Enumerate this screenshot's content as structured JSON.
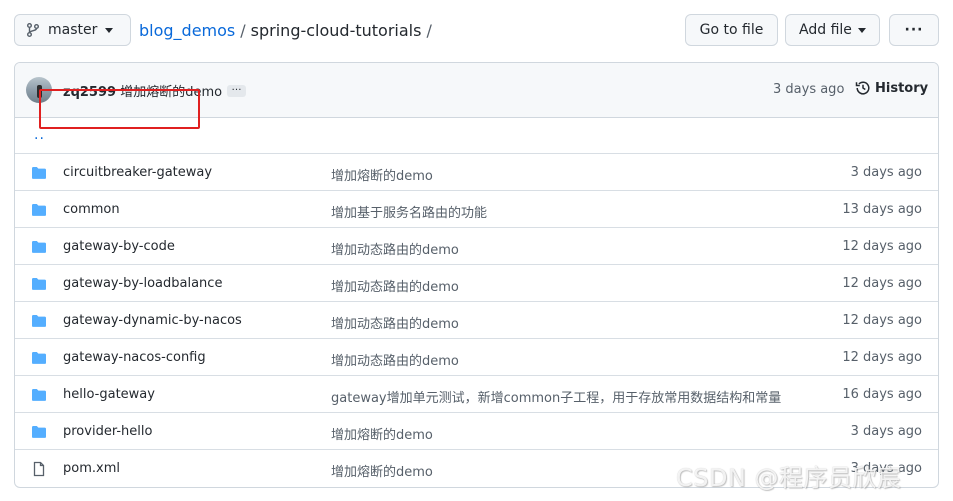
{
  "toolbar": {
    "branch": "master",
    "breadcrumb": {
      "owner": "blog_demos",
      "separator": "/",
      "repo": "spring-cloud-tutorials",
      "trailing": "/"
    },
    "goto_file": "Go to file",
    "add_file": "Add file",
    "more": "···"
  },
  "commit": {
    "author": "zq2599",
    "message": "增加熔断的demo",
    "ellipsis": "…",
    "time": "3 days ago",
    "history": "History"
  },
  "updir": "..",
  "files": [
    {
      "name": "circuitbreaker-gateway",
      "type": "dir",
      "message": "增加熔断的demo",
      "time": "3 days ago"
    },
    {
      "name": "common",
      "type": "dir",
      "message": "增加基于服务名路由的功能",
      "time": "13 days ago"
    },
    {
      "name": "gateway-by-code",
      "type": "dir",
      "message": "增加动态路由的demo",
      "time": "12 days ago"
    },
    {
      "name": "gateway-by-loadbalance",
      "type": "dir",
      "message": "增加动态路由的demo",
      "time": "12 days ago"
    },
    {
      "name": "gateway-dynamic-by-nacos",
      "type": "dir",
      "message": "增加动态路由的demo",
      "time": "12 days ago"
    },
    {
      "name": "gateway-nacos-config",
      "type": "dir",
      "message": "增加动态路由的demo",
      "time": "12 days ago"
    },
    {
      "name": "hello-gateway",
      "type": "dir",
      "message": "gateway增加单元测试，新增common子工程，用于存放常用数据结构和常量",
      "time": "16 days ago"
    },
    {
      "name": "provider-hello",
      "type": "dir",
      "message": "增加熔断的demo",
      "time": "3 days ago"
    },
    {
      "name": "pom.xml",
      "type": "file",
      "message": "增加熔断的demo",
      "time": "3 days ago"
    }
  ],
  "watermark": "CSDN @程序员欣宸",
  "colors": {
    "link": "#0969da",
    "folder": "#54aeff",
    "highlight": "#e02020",
    "muted": "#57606a"
  },
  "icons": {
    "branch": "git-branch-icon",
    "history": "history-icon",
    "folder": "folder-icon",
    "file": "file-icon"
  }
}
